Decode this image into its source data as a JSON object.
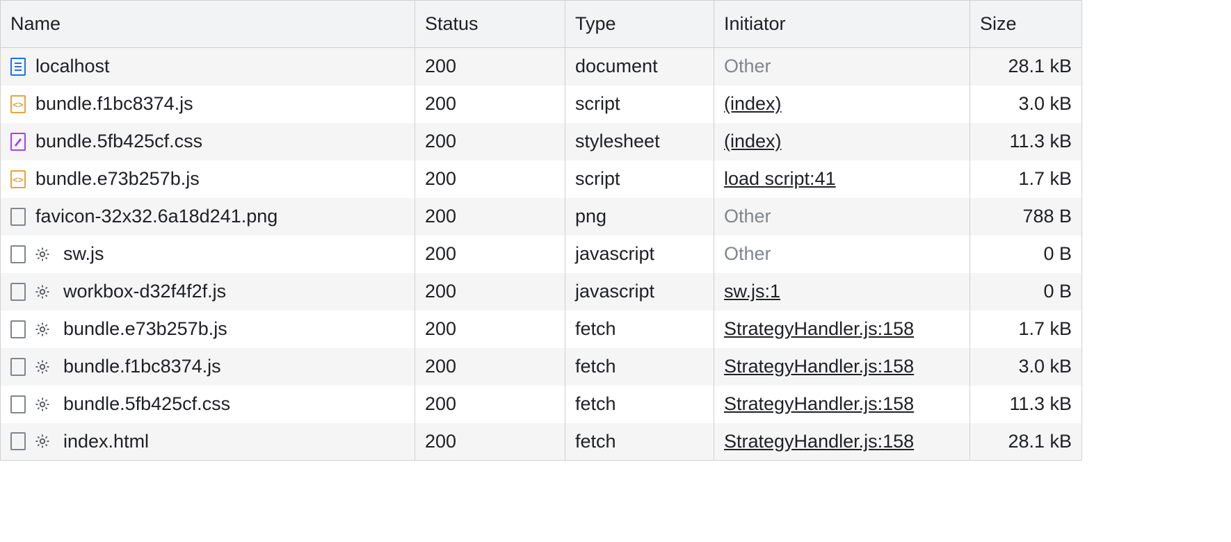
{
  "columns": {
    "name": "Name",
    "status": "Status",
    "type": "Type",
    "initiator": "Initiator",
    "size": "Size"
  },
  "rows": [
    {
      "icon": "document",
      "gear": false,
      "name": "localhost",
      "status": "200",
      "type": "document",
      "initiator": "Other",
      "initiator_link": false,
      "size": "28.1 kB"
    },
    {
      "icon": "script",
      "gear": false,
      "name": "bundle.f1bc8374.js",
      "status": "200",
      "type": "script",
      "initiator": "(index)",
      "initiator_link": true,
      "size": "3.0 kB"
    },
    {
      "icon": "stylesheet",
      "gear": false,
      "name": "bundle.5fb425cf.css",
      "status": "200",
      "type": "stylesheet",
      "initiator": "(index)",
      "initiator_link": true,
      "size": "11.3 kB"
    },
    {
      "icon": "script",
      "gear": false,
      "name": "bundle.e73b257b.js",
      "status": "200",
      "type": "script",
      "initiator": "load script:41",
      "initiator_link": true,
      "size": "1.7 kB"
    },
    {
      "icon": "generic",
      "gear": false,
      "name": "favicon-32x32.6a18d241.png",
      "status": "200",
      "type": "png",
      "initiator": "Other",
      "initiator_link": false,
      "size": "788 B"
    },
    {
      "icon": "generic",
      "gear": true,
      "name": "sw.js",
      "status": "200",
      "type": "javascript",
      "initiator": "Other",
      "initiator_link": false,
      "size": "0 B"
    },
    {
      "icon": "generic",
      "gear": true,
      "name": "workbox-d32f4f2f.js",
      "status": "200",
      "type": "javascript",
      "initiator": "sw.js:1",
      "initiator_link": true,
      "size": "0 B"
    },
    {
      "icon": "generic",
      "gear": true,
      "name": "bundle.e73b257b.js",
      "status": "200",
      "type": "fetch",
      "initiator": "StrategyHandler.js:158",
      "initiator_link": true,
      "size": "1.7 kB"
    },
    {
      "icon": "generic",
      "gear": true,
      "name": "bundle.f1bc8374.js",
      "status": "200",
      "type": "fetch",
      "initiator": "StrategyHandler.js:158",
      "initiator_link": true,
      "size": "3.0 kB"
    },
    {
      "icon": "generic",
      "gear": true,
      "name": "bundle.5fb425cf.css",
      "status": "200",
      "type": "fetch",
      "initiator": "StrategyHandler.js:158",
      "initiator_link": true,
      "size": "11.3 kB"
    },
    {
      "icon": "generic",
      "gear": true,
      "name": "index.html",
      "status": "200",
      "type": "fetch",
      "initiator": "StrategyHandler.js:158",
      "initiator_link": true,
      "size": "28.1 kB"
    }
  ]
}
